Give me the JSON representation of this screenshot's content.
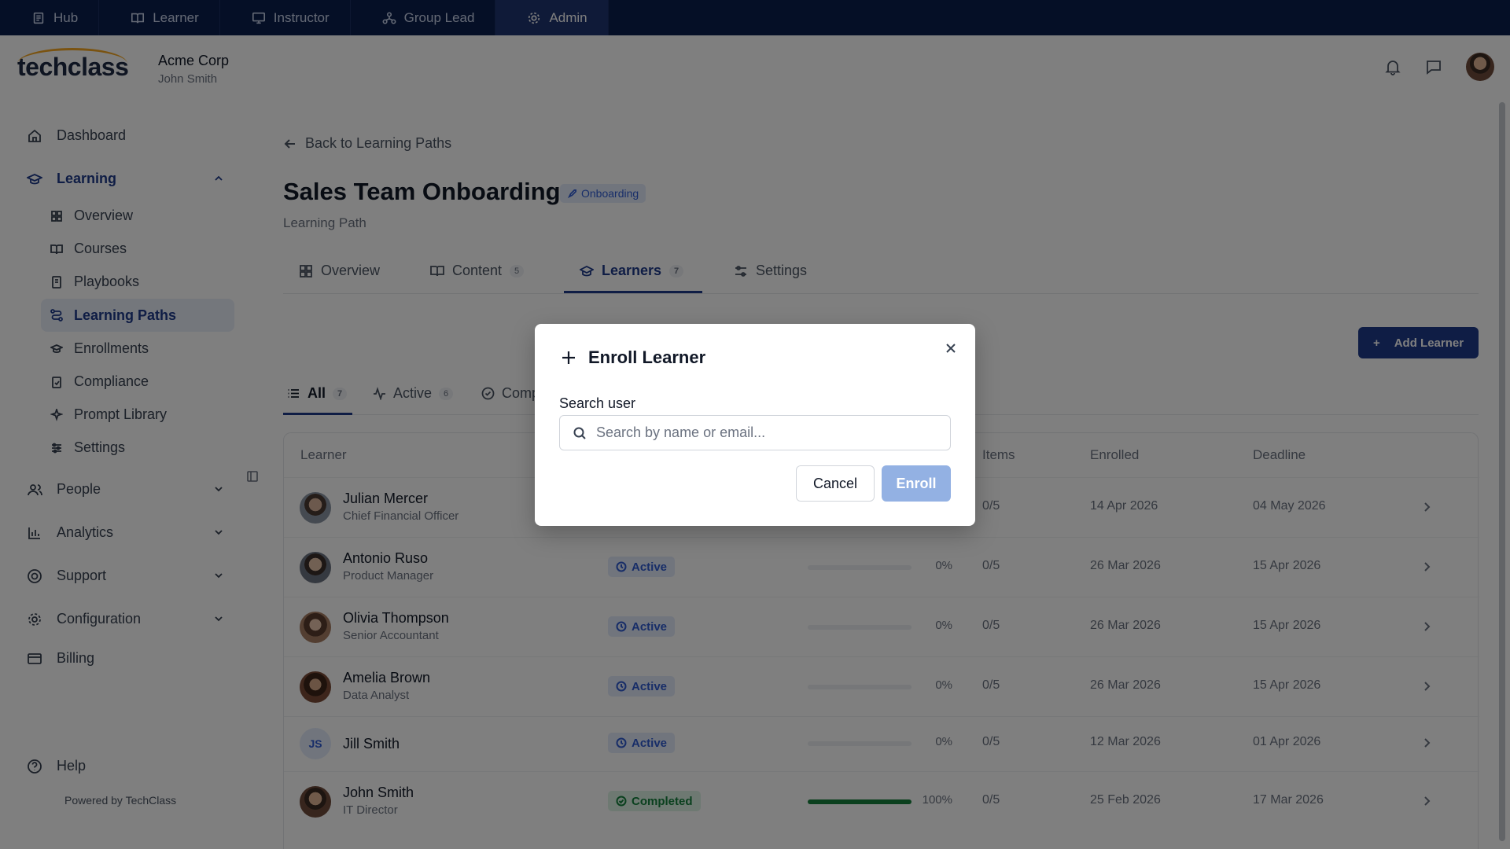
{
  "topnav": {
    "tabs": [
      {
        "label": "Hub",
        "icon": "hub-icon"
      },
      {
        "label": "Learner",
        "icon": "book-icon"
      },
      {
        "label": "Instructor",
        "icon": "monitor-icon"
      },
      {
        "label": "Group Lead",
        "icon": "group-icon"
      },
      {
        "label": "Admin",
        "icon": "gear-icon",
        "active": true
      }
    ]
  },
  "header": {
    "logo": "techclass",
    "org_name": "Acme Corp",
    "user_name": "John Smith"
  },
  "sidebar": {
    "dashboard": "Dashboard",
    "learning": "Learning",
    "learning_items": [
      "Overview",
      "Courses",
      "Playbooks",
      "Learning Paths",
      "Enrollments",
      "Compliance",
      "Prompt Library",
      "Settings"
    ],
    "active_item": "Learning Paths",
    "people": "People",
    "analytics": "Analytics",
    "support": "Support",
    "configuration": "Configuration",
    "billing": "Billing",
    "help": "Help",
    "powered_by": "Powered by TechClass"
  },
  "page": {
    "back_link": "Back to Learning Paths",
    "title": "Sales Team Onboarding",
    "badge": "Onboarding",
    "subtitle": "Learning Path",
    "tabs": [
      {
        "label": "Overview",
        "count": ""
      },
      {
        "label": "Content",
        "count": "5"
      },
      {
        "label": "Learners",
        "count": "7"
      },
      {
        "label": "Settings",
        "count": ""
      }
    ],
    "active_tab": "Learners",
    "add_button": "Add Learner",
    "filters": [
      {
        "label": "All",
        "count": "7"
      },
      {
        "label": "Active",
        "count": "6"
      },
      {
        "label": "Comp",
        "count": ""
      }
    ]
  },
  "table": {
    "headers": {
      "learner": "Learner",
      "items": "Items",
      "enrolled": "Enrolled",
      "deadline": "Deadline"
    },
    "rows": [
      {
        "name": "Julian Mercer",
        "role": "Chief Financial Officer",
        "status": "",
        "progress": "",
        "items": "0/5",
        "enrolled": "14 Apr 2026",
        "deadline": "04 May 2026"
      },
      {
        "name": "Antonio Ruso",
        "role": "Product Manager",
        "status": "Active",
        "progress": "0%",
        "items": "0/5",
        "enrolled": "26 Mar 2026",
        "deadline": "15 Apr 2026"
      },
      {
        "name": "Olivia Thompson",
        "role": "Senior Accountant",
        "status": "Active",
        "progress": "0%",
        "items": "0/5",
        "enrolled": "26 Mar 2026",
        "deadline": "15 Apr 2026"
      },
      {
        "name": "Amelia Brown",
        "role": "Data Analyst",
        "status": "Active",
        "progress": "0%",
        "items": "0/5",
        "enrolled": "26 Mar 2026",
        "deadline": "15 Apr 2026"
      },
      {
        "name": "Jill Smith",
        "role": "",
        "initials": "JS",
        "status": "Active",
        "progress": "0%",
        "items": "0/5",
        "enrolled": "12 Mar 2026",
        "deadline": "01 Apr 2026"
      },
      {
        "name": "John Smith",
        "role": "IT Director",
        "status": "Completed",
        "progress": "100%",
        "progress_fraction": 1.0,
        "items": "0/5",
        "enrolled": "25 Feb 2026",
        "deadline": "17 Mar 2026"
      }
    ]
  },
  "modal": {
    "title": "Enroll Learner",
    "search_label": "Search user",
    "search_placeholder": "Search by name or email...",
    "search_value": "",
    "cancel": "Cancel",
    "enroll": "Enroll"
  },
  "colors": {
    "topbar": "#0b1f4d",
    "primary": "#1e3a8a",
    "active_badge": "#2f5bd0",
    "completed": "#15803d",
    "enroll_disabled": "#93b1e3"
  }
}
